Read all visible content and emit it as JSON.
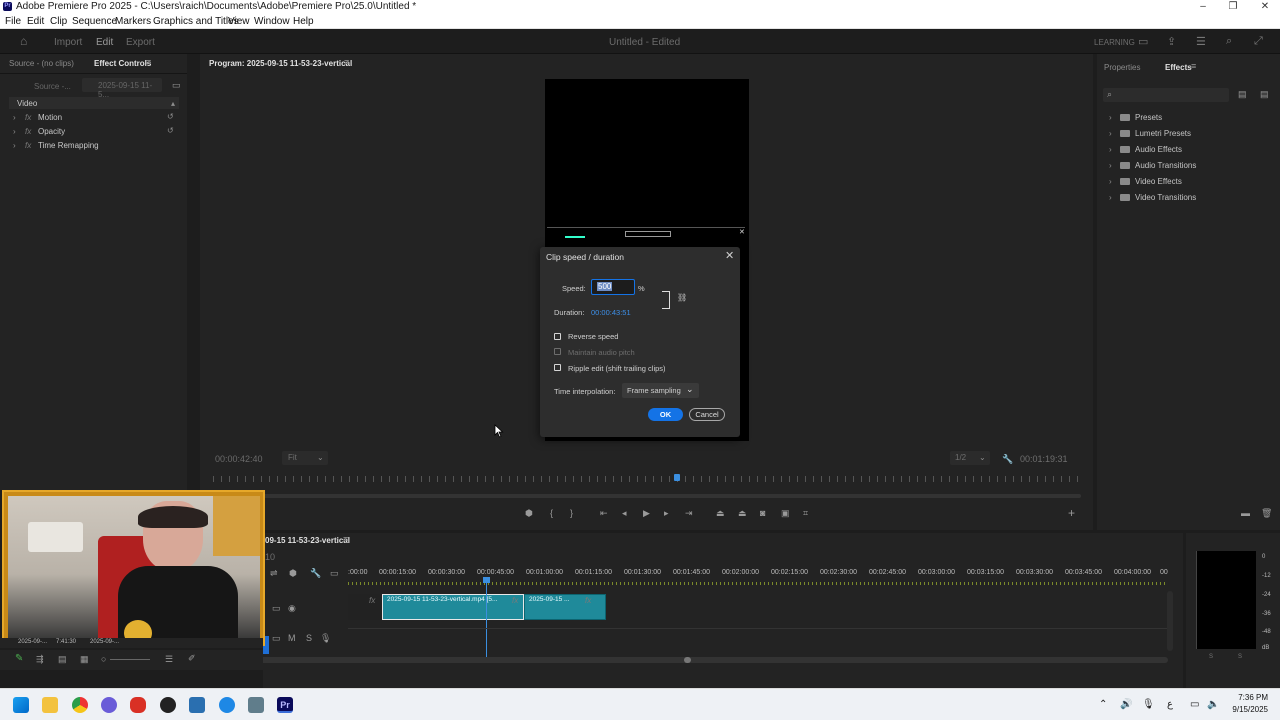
{
  "window": {
    "title": "Adobe Premiere Pro 2025 - C:\\Users\\raich\\Documents\\Adobe\\Premiere Pro\\25.0\\Untitled *",
    "controls": [
      "–",
      "❐",
      "✕"
    ]
  },
  "menu": [
    "File",
    "Edit",
    "Clip",
    "Sequence",
    "Markers",
    "Graphics and Titles",
    "View",
    "Window",
    "Help"
  ],
  "header": {
    "tabs": [
      "Import",
      "Edit",
      "Export"
    ],
    "active_tab": "Edit",
    "project_title": "Untitled - Edited",
    "learning_label": "LEARNING"
  },
  "source_panel": {
    "tab_source": "Source - (no clips)",
    "tab_effect_controls": "Effect Controls",
    "sub_source": "Source -...",
    "sub_clip": "2025-09-15 11-5...",
    "section": "Video",
    "rows": [
      {
        "label": "Motion",
        "fx": "fx"
      },
      {
        "label": "Opacity",
        "fx": "fx"
      },
      {
        "label": "Time Remapping",
        "fx": "fx"
      }
    ]
  },
  "program": {
    "title": "Program: 2025-09-15 11-53-23-vertical",
    "timecode_left": "00:00:42:40",
    "fit": "Fit",
    "resolution": "1/2",
    "timecode_right": "00:01:19:31"
  },
  "dialog": {
    "title": "Clip speed / duration",
    "speed_label": "Speed:",
    "speed_value": "500",
    "percent": "%",
    "duration_label": "Duration:",
    "duration_value": "00:00:43:51",
    "reverse_speed": "Reverse speed",
    "maintain_pitch": "Maintain audio pitch",
    "ripple_edit": "Ripple edit (shift trailing clips)",
    "interp_label": "Time interpolation:",
    "interp_value": "Frame sampling",
    "ok": "OK",
    "cancel": "Cancel"
  },
  "right_panel": {
    "tab_properties": "Properties",
    "tab_effects": "Effects",
    "items": [
      "Presets",
      "Lumetri Presets",
      "Audio Effects",
      "Audio Transitions",
      "Video Effects",
      "Video Transitions"
    ]
  },
  "timeline": {
    "sequence_name": "09-15 11-53-23-vertical",
    "timecode_fragment": "10",
    "ruler": [
      ":00:00",
      "00:00:15:00",
      "00:00:30:00",
      "00:00:45:00",
      "00:01:00:00",
      "00:01:15:00",
      "00:01:30:00",
      "00:01:45:00",
      "00:02:00:00",
      "00:02:15:00",
      "00:02:30:00",
      "00:02:45:00",
      "00:03:00:00",
      "00:03:15:00",
      "00:03:30:00",
      "00:03:45:00",
      "00:04:00:00",
      "00"
    ],
    "clips": [
      {
        "name": "2025-09-15 11-53-23-vertical.mp4 [5..."
      },
      {
        "name": "2025-09-15 ..."
      }
    ],
    "bottom_left": [
      "2025-09-...",
      "7:41:30",
      "2025-09-..."
    ],
    "fx": "fx"
  },
  "meter": {
    "labels": [
      "0",
      "-12",
      "-24",
      "-36",
      "-48",
      "dB"
    ],
    "bottom": [
      "S",
      "S"
    ]
  },
  "taskbar": {
    "time": "7:36 PM",
    "date": "9/15/2025"
  },
  "colors": {
    "accent": "#1473e6",
    "clip": "#1f8a9a",
    "playhead": "#3b8fe0"
  }
}
